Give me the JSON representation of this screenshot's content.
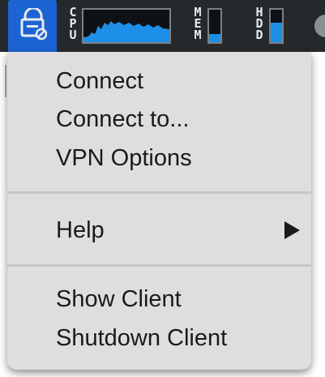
{
  "menubar": {
    "vpn_icon": "vpn-lock-icon",
    "cpu": {
      "label": "C\nP\nU"
    },
    "mem": {
      "label": "M\nE\nM",
      "level": 0.25
    },
    "hdd": {
      "label": "H\nD\nD",
      "level": 0.6
    },
    "accent_color": "#1c64d4",
    "graph_color": "#1d8fe6"
  },
  "menu": {
    "items": [
      {
        "label": "Connect"
      },
      {
        "label": "Connect to..."
      },
      {
        "label": "VPN Options"
      },
      {
        "label": "Help",
        "submenu": true
      },
      {
        "label": "Show Client"
      },
      {
        "label": "Shutdown Client"
      }
    ]
  }
}
